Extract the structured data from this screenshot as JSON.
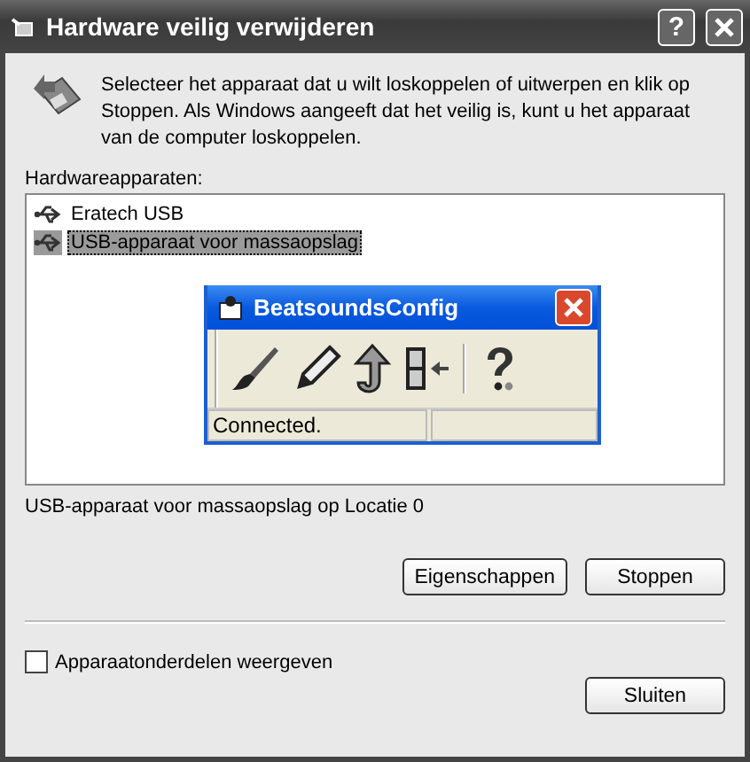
{
  "window": {
    "title": "Hardware veilig verwijderen",
    "help": "?"
  },
  "instruction": "Selecteer het apparaat dat u wilt loskoppelen of uitwerpen en klik op Stoppen. Als Windows aangeeft dat het veilig is, kunt u het apparaat van de computer loskoppelen.",
  "list_label": "Hardwareapparaten:",
  "devices": [
    {
      "label": "Eratech USB",
      "selected": false
    },
    {
      "label": "USB-apparaat voor massaopslag",
      "selected": true
    }
  ],
  "popup": {
    "title": "BeatsoundsConfig",
    "tools": [
      {
        "kind": "brush"
      },
      {
        "kind": "pencil"
      },
      {
        "kind": "upload"
      },
      {
        "kind": "exit"
      },
      {
        "kind": "help"
      }
    ],
    "status": "Connected."
  },
  "location": "USB-apparaat voor massaopslag op Locatie 0",
  "actions": [
    "Eigenschappen",
    "Stoppen"
  ],
  "checkbox": {
    "label": "Apparaatonderdelen weergeven",
    "checked": false
  },
  "close_button": "Sluiten"
}
